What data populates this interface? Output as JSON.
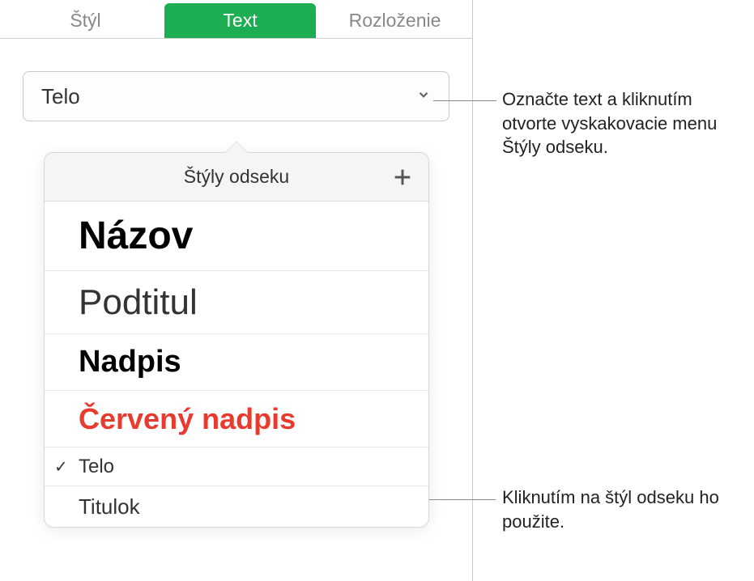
{
  "tabs": {
    "style": "Štýl",
    "text": "Text",
    "layout": "Rozloženie"
  },
  "dropdown": {
    "selected": "Telo"
  },
  "popover": {
    "title": "Štýly odseku",
    "items": [
      {
        "label": "Názov",
        "class": "nazov",
        "checked": false
      },
      {
        "label": "Podtitul",
        "class": "podtitul",
        "checked": false
      },
      {
        "label": "Nadpis",
        "class": "nadpis",
        "checked": false
      },
      {
        "label": "Červený nadpis",
        "class": "cerveny",
        "checked": false
      },
      {
        "label": "Telo",
        "class": "telo",
        "checked": true
      },
      {
        "label": "Titulok",
        "class": "titulok",
        "checked": false
      }
    ]
  },
  "callouts": {
    "c1": "Označte text a kliknutím otvorte vyskakovacie menu Štýly odseku.",
    "c2": "Kliknutím na štýl odseku ho použite."
  }
}
